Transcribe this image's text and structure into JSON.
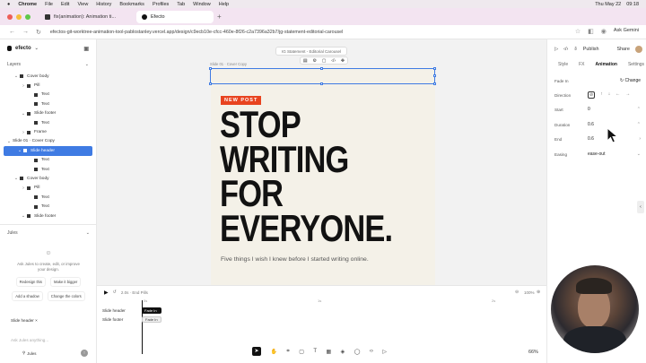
{
  "menubar": {
    "apple": "",
    "items": [
      "Chrome",
      "File",
      "Edit",
      "View",
      "History",
      "Bookmarks",
      "Profiles",
      "Tab",
      "Window",
      "Help"
    ],
    "right": [
      "Thu May 22",
      "09:18"
    ]
  },
  "tabs": [
    {
      "label": "fix(animation): Animation ti...",
      "active": false
    },
    {
      "label": "Efecto",
      "active": true
    }
  ],
  "address": {
    "url": "efectos-git-worktree-animation-tool-pablostanley.vercel.app/design/c9ecb10e-cfcc-460e-8f26-c2a7396a32b7/jg-statement-editorial-carousel"
  },
  "ask_gemini": "Ask Gemini",
  "app": {
    "name": "efecto"
  },
  "layers": {
    "title": "Layers",
    "items": [
      {
        "label": "Cover body",
        "indent": 1,
        "chev": "⌄"
      },
      {
        "label": "Pill",
        "indent": 2,
        "chev": "›"
      },
      {
        "label": "Text",
        "indent": 3,
        "chev": ""
      },
      {
        "label": "Text",
        "indent": 3,
        "chev": ""
      },
      {
        "label": "Slide footer",
        "indent": 2,
        "chev": "⌄"
      },
      {
        "label": "Text",
        "indent": 3,
        "chev": ""
      },
      {
        "label": "Frame",
        "indent": 2,
        "chev": "›"
      },
      {
        "label": "Slide 01 · Cover Copy",
        "indent": 0,
        "chev": "⌄"
      },
      {
        "label": "Slide header",
        "indent": 1,
        "chev": "⌄",
        "selected": true
      },
      {
        "label": "Text",
        "indent": 3,
        "chev": ""
      },
      {
        "label": "Text",
        "indent": 3,
        "chev": ""
      },
      {
        "label": "Cover body",
        "indent": 1,
        "chev": "⌄"
      },
      {
        "label": "Pill",
        "indent": 2,
        "chev": "›"
      },
      {
        "label": "Text",
        "indent": 3,
        "chev": ""
      },
      {
        "label": "Text",
        "indent": 3,
        "chev": ""
      },
      {
        "label": "Slide footer",
        "indent": 2,
        "chev": "⌄"
      }
    ]
  },
  "jules": {
    "title": "Jules",
    "message": "Ask Jules to create, edit, or improve your design.",
    "chips": [
      "Redesign this",
      "Make it bigger",
      "Add a shadow",
      "Change the colors"
    ],
    "context": "Slide header",
    "placeholder": "Ask Jules anything...",
    "model": "Jules"
  },
  "canvas": {
    "float_label": "IG Statement - Editorial Carousel",
    "slide_label": "Slide 01 · Cover Copy",
    "badge": "NEW POST",
    "headline": [
      "STOP",
      "WRITING",
      "FOR",
      "EVERYONE."
    ],
    "subline": "Five things I wish I knew before I started writing online."
  },
  "timeline": {
    "head": "2.0s · End Pills",
    "time_marks": [
      "0s",
      "1s",
      "2s"
    ],
    "zoom": "100%",
    "rows": [
      {
        "label": "Slide header",
        "pill": "Fade In"
      },
      {
        "label": "Slide footer",
        "pill": "Fade In"
      }
    ]
  },
  "zoom_level": "66%",
  "right_panel": {
    "publish": "Publish",
    "share": "Share",
    "tabs": [
      "Style",
      "FX",
      "Animation",
      "Settings"
    ],
    "active_tab": "Animation",
    "effect": "Fade In",
    "change": "Change",
    "fields": [
      {
        "label": "Direction",
        "value": ""
      },
      {
        "label": "Start",
        "value": "0"
      },
      {
        "label": "Duration",
        "value": "0.6"
      },
      {
        "label": "End",
        "value": "0.6"
      },
      {
        "label": "Easing",
        "value": "ease-out"
      }
    ]
  },
  "colors": {
    "accent": "#3f7be3",
    "badge": "#e8431f",
    "slide_bg": "#f4f1e8",
    "tab_bg": "#f3e4f1"
  }
}
